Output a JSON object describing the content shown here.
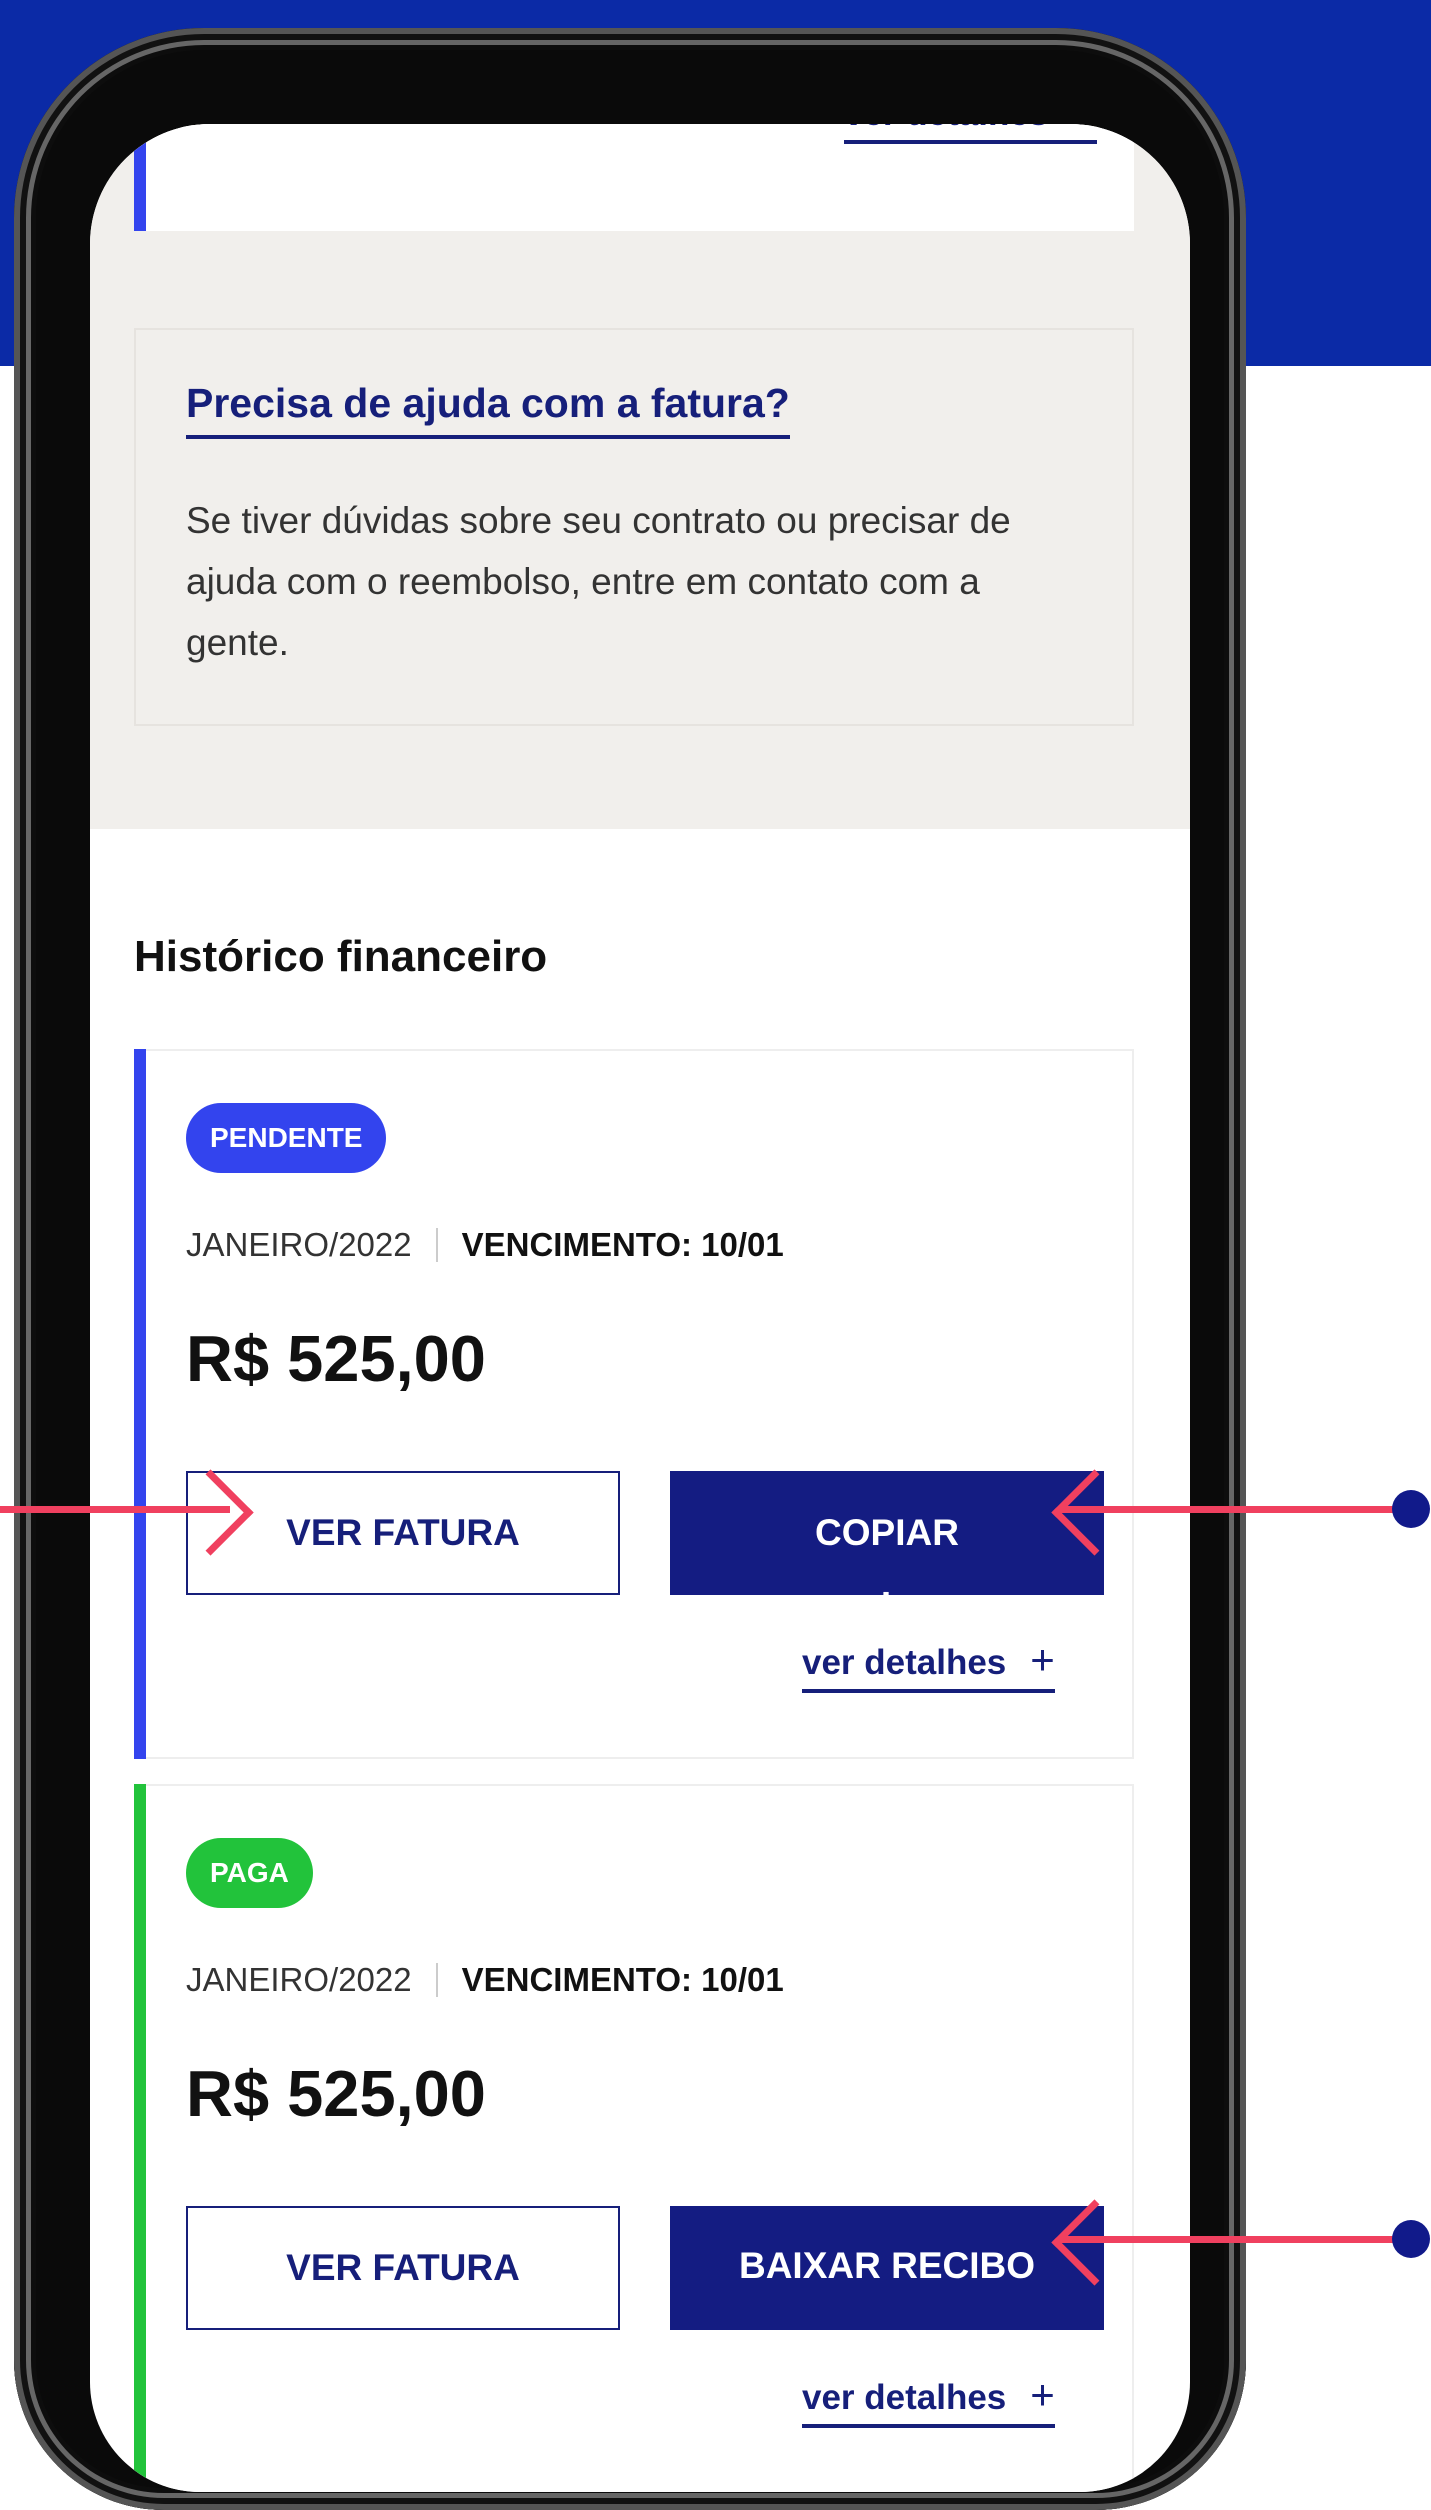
{
  "colors": {
    "banner": "#0b2aa6",
    "primary": "#161f7a",
    "pending_accent": "#3344ee",
    "paid_accent": "#22c33b",
    "annotation": "#f0405f"
  },
  "top_card": {
    "details_link": "ver detalhes",
    "plus_icon": "+"
  },
  "help": {
    "title": "Precisa de ajuda com a fatura?",
    "body": "Se tiver dúvidas sobre seu contrato ou precisar de ajuda com o reembolso, entre em contato com a gente."
  },
  "history": {
    "title": "Histórico financeiro",
    "records": [
      {
        "status": "PENDENTE",
        "month": "JANEIRO/2022",
        "due": "VENCIMENTO: 10/01",
        "amount": "R$ 525,00",
        "view_button": "VER FATURA",
        "action_button": "COPIAR",
        "action_overflow": "·",
        "details_link": "ver detalhes",
        "plus_icon": "+"
      },
      {
        "status": "PAGA",
        "month": "JANEIRO/2022",
        "due": "VENCIMENTO: 10/01",
        "amount": "R$ 525,00",
        "view_button": "VER FATURA",
        "action_button": "BAIXAR RECIBO",
        "details_link": "ver detalhes",
        "plus_icon": "+"
      }
    ]
  },
  "icons": {
    "annotation_arrow_left": "arrow-right-icon",
    "annotation_arrow_copy": "arrow-left-icon",
    "annotation_arrow_receipt": "arrow-left-icon"
  }
}
